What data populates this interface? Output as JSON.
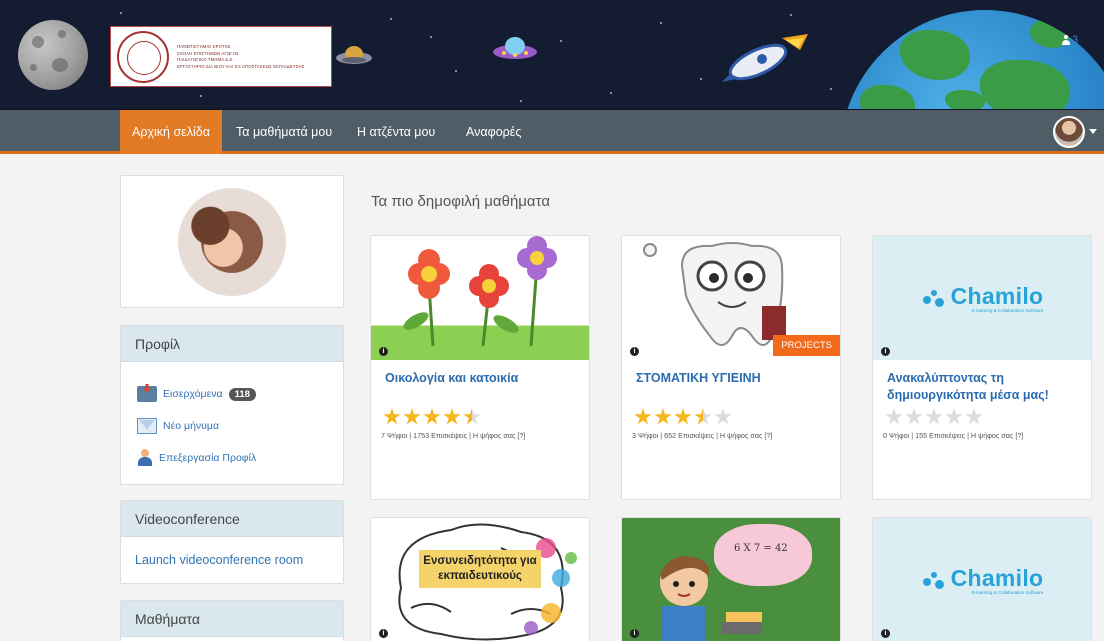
{
  "header": {
    "logo_lines": [
      "ΠΑΝΕΠΙΣΤΗΜΙΟ ΚΡΗΤΗΣ",
      "ΣΧΟΛΗ ΕΠΙΣΤΗΜΩΝ ΑΓΩΓΗΣ",
      "ΠΑΙΔΑΓΩΓΙΚΟ ΤΜΗΜΑ Δ.Ε.",
      "ΕΡΓΑΣΤΗΡΙΟ ΔΙΑ ΒΙΟΥ ΚΑΙ ΕΞ ΑΠΟΣΤΑΣΕΩΣ ΕΚΠΑΙΔΕΥΣΗΣ"
    ],
    "online_users": "3"
  },
  "nav": {
    "items": [
      "Αρχική σελίδα",
      "Τα μαθήματά μου",
      "Η ατζέντα μου",
      "Αναφορές"
    ],
    "active_index": 0
  },
  "sidebar": {
    "profile": {
      "title": "Προφίλ",
      "inbox_label": "Εισερχόμενα",
      "inbox_count": "118",
      "new_message_label": "Νέο μήνυμα",
      "edit_profile_label": "Επεξεργασία Προφίλ"
    },
    "videoconference": {
      "title": "Videoconference",
      "link": "Launch videoconference room"
    },
    "courses": {
      "title": "Μαθήματα"
    }
  },
  "main": {
    "section_title": "Τα πιο δημοφιλή μαθήματα",
    "courses": [
      {
        "title": "Οικολογία και κατοικία",
        "rating": 4.5,
        "meta": "7 Ψήφοι | 1753 Επισκέψεις | Η ψήφος σας [?]"
      },
      {
        "title": "ΣΤΟΜΑΤΙΚΗ ΥΓΙΕΙΝΗ",
        "tag": "PROJECTS",
        "rating": 3.5,
        "meta": "3 Ψήφοι | 652 Επισκέψεις | Η ψήφος σας [?]"
      },
      {
        "title": "Ανακαλύπτοντας τη δημιουργικότητα μέσα μας!",
        "rating": 0,
        "meta": "0 Ψήφοι | 155 Επισκέψεις | Η ψήφος σας [?]"
      }
    ],
    "brain_label": "Ενσυνειδητότητα για εκπαιδευτικούς",
    "math_text": "6 X 7 = 42",
    "chamilo_word": "Chamilo",
    "chamilo_tagline": "E-learning & Collaboration Software",
    "info_glyph": "i"
  },
  "colors": {
    "nav_active": "#e37a24",
    "nav_bg": "#4e5d66",
    "link": "#3173b5",
    "star": "#f5b81c",
    "projects": "#f26b1d",
    "chamilo": "#27a3d9"
  }
}
